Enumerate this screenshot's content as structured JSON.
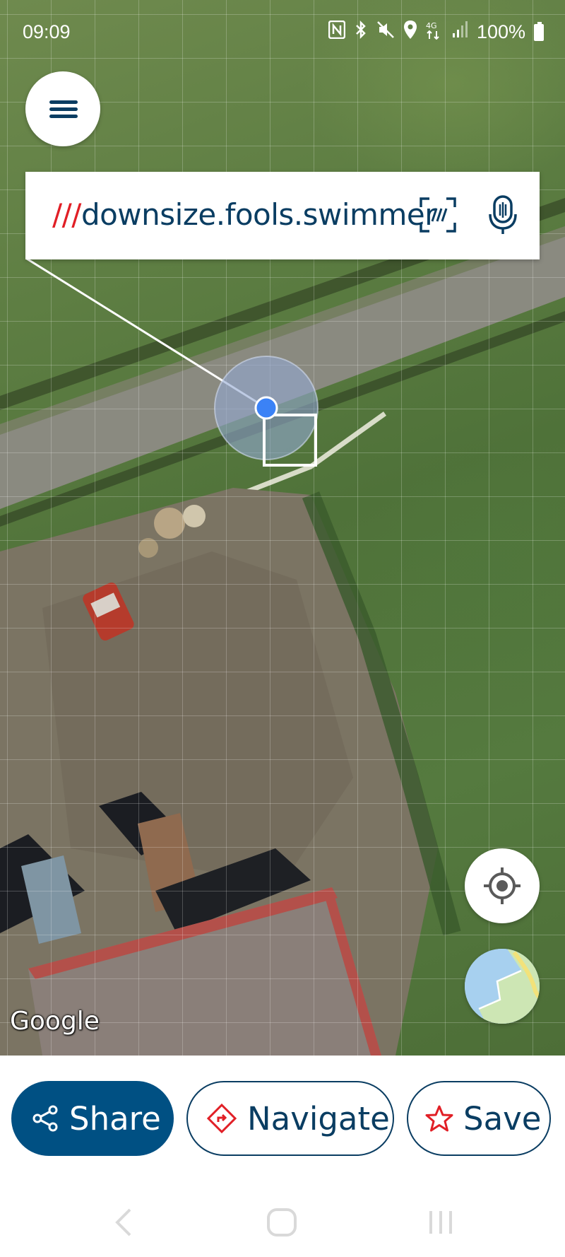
{
  "status_bar": {
    "time": "09:09",
    "battery": "100%",
    "icons": [
      "nfc-icon",
      "bluetooth-icon",
      "mute-icon",
      "location-icon",
      "4g-icon",
      "signal-icon",
      "battery-icon"
    ]
  },
  "search": {
    "prefix": "///",
    "address": "downsize.fools.swimmer"
  },
  "map": {
    "attribution": "Google",
    "layer": "satellite",
    "accent": "#e11f26",
    "location_dot_color": "#3b82f6"
  },
  "actions": {
    "share": "Share",
    "navigate": "Navigate",
    "save": "Save"
  },
  "colors": {
    "primary": "#005083",
    "text": "#0a3d62",
    "accent": "#e11f26"
  }
}
